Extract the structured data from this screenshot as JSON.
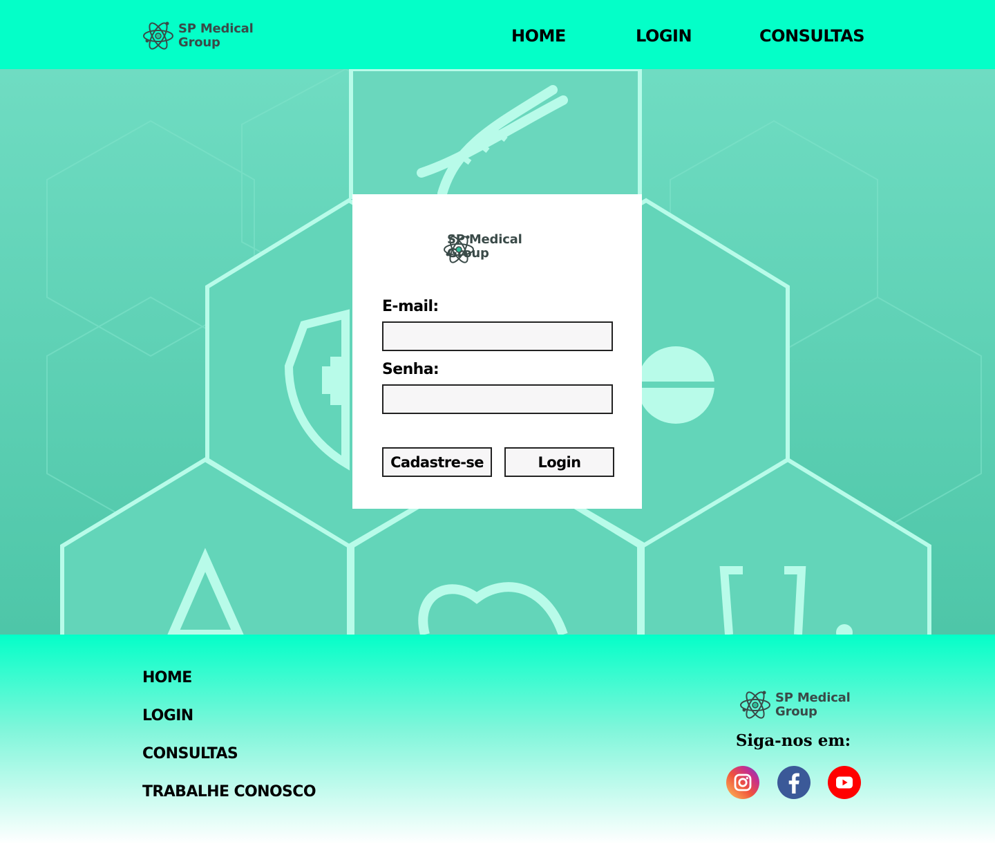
{
  "brand": {
    "line1": "SP Medical",
    "line2": "Group"
  },
  "header": {
    "nav": [
      {
        "label": "HOME"
      },
      {
        "label": "LOGIN"
      },
      {
        "label": "CONSULTAS"
      }
    ]
  },
  "login_form": {
    "email_label": "E-mail:",
    "email_value": "",
    "password_label": "Senha:",
    "password_value": "",
    "signup_button": "Cadastre-se",
    "login_button": "Login"
  },
  "footer": {
    "links": [
      {
        "label": "HOME"
      },
      {
        "label": "LOGIN"
      },
      {
        "label": "CONSULTAS"
      },
      {
        "label": "TRABALHE CONOSCO"
      }
    ],
    "follow_text": "Siga-nos em:",
    "social": [
      "instagram-icon",
      "facebook-icon",
      "youtube-icon"
    ]
  },
  "colors": {
    "header_bg": "#04ffc8",
    "hero_bg": "#5fd3b7",
    "card_bg": "#ffffff",
    "youtube": "#ff0000",
    "facebook": "#3b5998"
  }
}
